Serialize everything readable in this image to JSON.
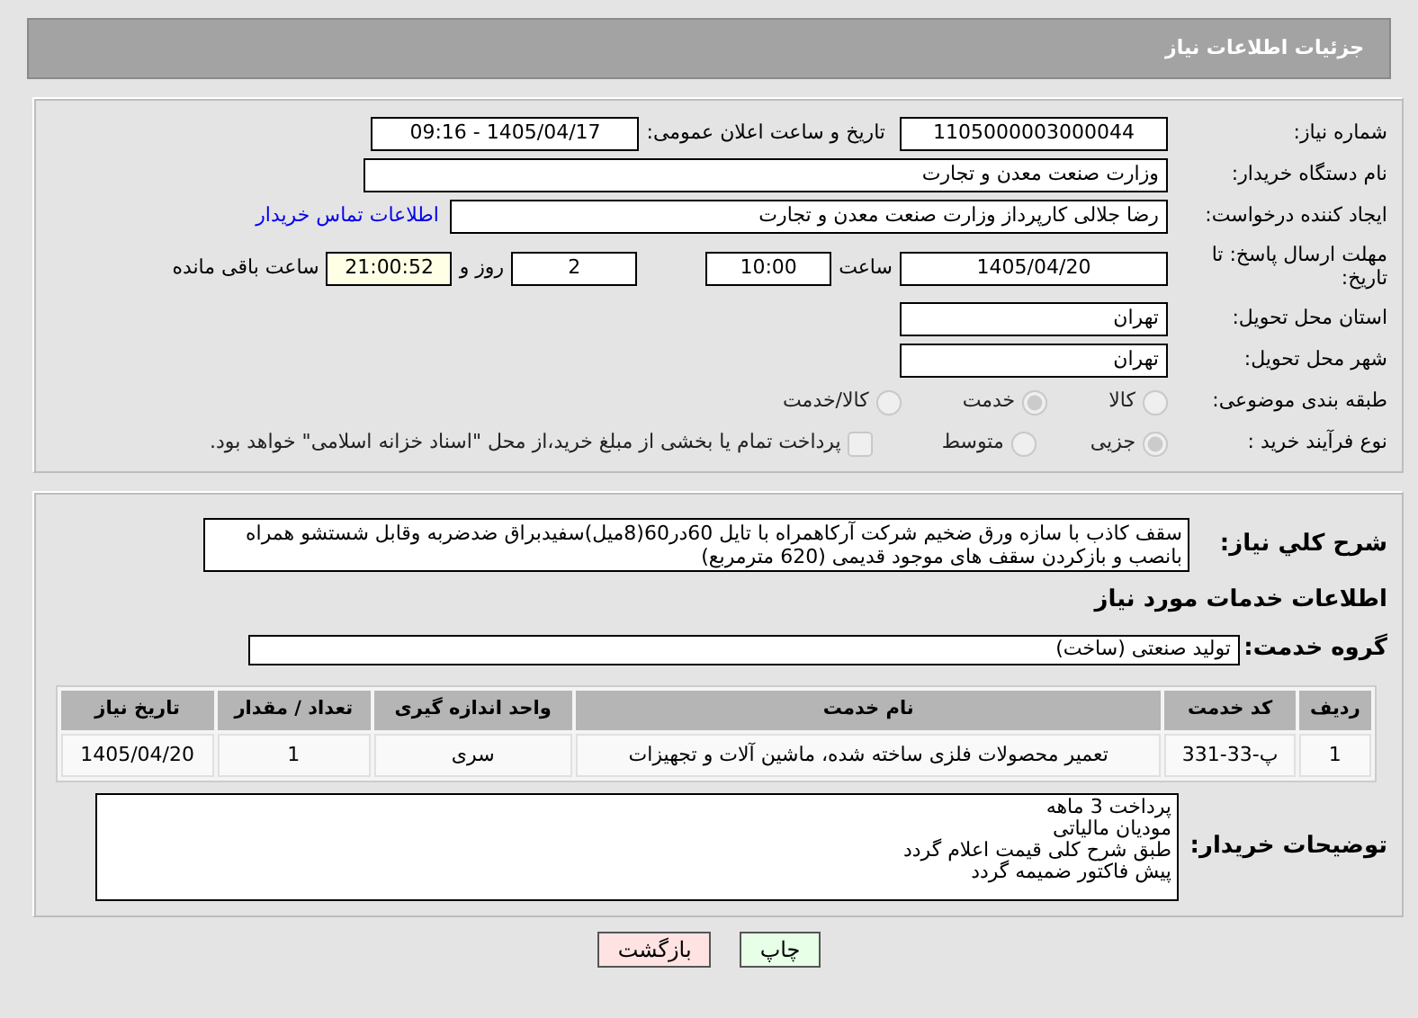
{
  "header": {
    "title": "جزئیات اطلاعات نیاز"
  },
  "need_number": {
    "label": "شماره نیاز:",
    "value": "1105000003000044"
  },
  "announce": {
    "label": "تاریخ و ساعت اعلان عمومی:",
    "value": "1405/04/17 - 09:16"
  },
  "buyer": {
    "label": "نام دستگاه خریدار:",
    "value": "وزارت صنعت معدن و تجارت"
  },
  "creator": {
    "label": "ایجاد کننده درخواست:",
    "value": "رضا جلالی کارپرداز وزارت صنعت معدن و تجارت",
    "link": "اطلاعات تماس خریدار"
  },
  "deadline": {
    "label": "مهلت ارسال پاسخ: تا تاریخ:",
    "date": "1405/04/20",
    "time_label": "ساعت",
    "time": "10:00",
    "days": "2",
    "days_label": "روز و",
    "remaining": "21:00:52",
    "remaining_label": "ساعت باقی مانده"
  },
  "province": {
    "label": "استان محل تحویل:",
    "value": "تهران"
  },
  "city": {
    "label": "شهر محل تحویل:",
    "value": "تهران"
  },
  "category": {
    "label": "طبقه بندی موضوعی:",
    "disabled": true,
    "options": [
      {
        "label": "کالا",
        "selected": false
      },
      {
        "label": "خدمت",
        "selected": true
      },
      {
        "label": "کالا/خدمت",
        "selected": false
      }
    ]
  },
  "process": {
    "label": "نوع فرآیند خرید :",
    "disabled": true,
    "options": [
      {
        "label": "جزیی",
        "selected": true
      },
      {
        "label": "متوسط",
        "selected": false
      }
    ],
    "payment": {
      "label": "پرداخت تمام یا بخشی از مبلغ خرید،از محل \"اسناد خزانه اسلامی\" خواهد بود.",
      "checked": false
    }
  },
  "description": {
    "label": "شرح کلي نياز:",
    "value": "سقف کاذب با سازه ورق ضخیم شرکت آرکاهمراه با تایل 60در60(8میل)سفیدبراق ضدضربه وقابل شستشو همراه بانصب و بازکردن سقف های موجود قدیمی (620 مترمربع)"
  },
  "services_title": "اطلاعات خدمات مورد نیاز",
  "service_group": {
    "label": "گروه خدمت:",
    "value": "تولید صنعتی (ساخت)"
  },
  "table": {
    "columns": [
      "ردیف",
      "کد خدمت",
      "نام خدمت",
      "واحد اندازه گیری",
      "تعداد / مقدار",
      "تاریخ نیاز"
    ],
    "rows": [
      [
        "1",
        "پ-33-331",
        "تعمیر محصولات فلزی ساخته شده، ماشین آلات و تجهیزات",
        "سری",
        "1",
        "1405/04/20"
      ]
    ]
  },
  "buyer_notes": {
    "label": "توضیحات خریدار:",
    "lines": [
      "پرداخت 3 ماهه",
      "مودیان مالیاتی",
      "طبق شرح کلی قیمت اعلام گردد",
      "پیش فاکتور ضمیمه گردد"
    ]
  },
  "buttons": [
    {
      "label": "چاپ",
      "kind": "print"
    },
    {
      "label": "بازگشت",
      "kind": "back"
    }
  ]
}
